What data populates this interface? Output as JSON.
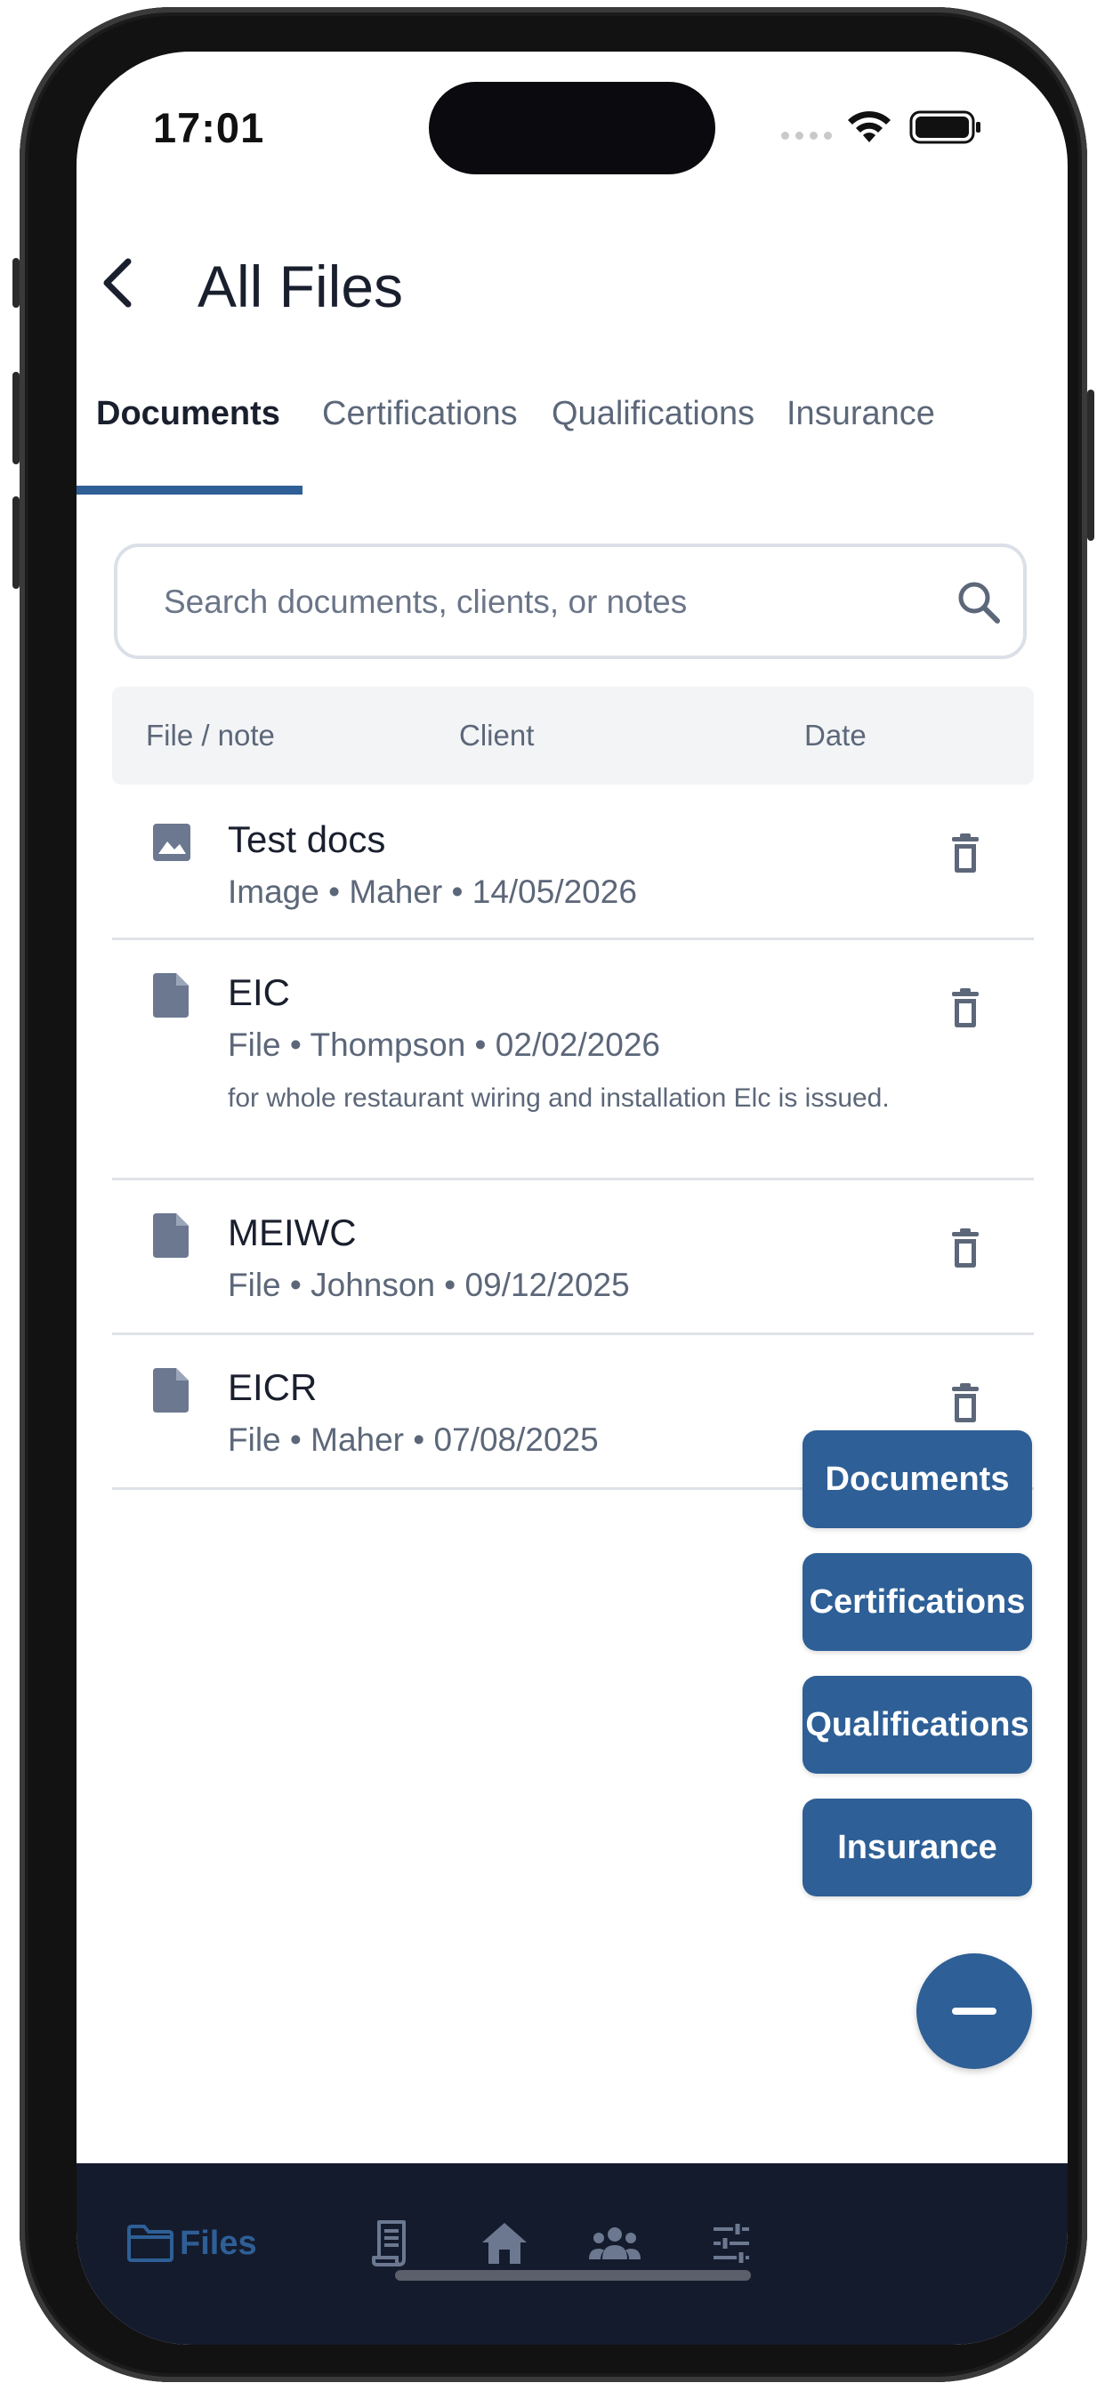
{
  "status_bar": {
    "time": "17:01"
  },
  "header": {
    "title": "All Files"
  },
  "tabs": [
    {
      "label": "Documents",
      "active": true
    },
    {
      "label": "Certifications",
      "active": false
    },
    {
      "label": "Qualifications",
      "active": false
    },
    {
      "label": "Insurance",
      "active": false
    }
  ],
  "search": {
    "placeholder": "Search documents, clients, or notes",
    "value": ""
  },
  "table": {
    "columns": [
      "File / note",
      "Client",
      "Date"
    ],
    "rows": [
      {
        "icon": "image-icon",
        "title": "Test docs",
        "meta": "Image • Maher • 14/05/2026",
        "note": ""
      },
      {
        "icon": "file-icon",
        "title": "EIC",
        "meta": "File • Thompson • 02/02/2026",
        "note": "for whole restaurant wiring and installation Elc is issued."
      },
      {
        "icon": "file-icon",
        "title": "MEIWC",
        "meta": "File • Johnson • 09/12/2025",
        "note": ""
      },
      {
        "icon": "file-icon",
        "title": "EICR",
        "meta": "File • Maher • 07/08/2025",
        "note": ""
      }
    ]
  },
  "fab_menu": {
    "items": [
      "Documents",
      "Certifications",
      "Qualifications",
      "Insurance"
    ]
  },
  "bottom_nav": {
    "items": [
      {
        "icon": "folder-icon",
        "label": "Files",
        "active": true
      },
      {
        "icon": "receipt-icon",
        "label": "",
        "active": false
      },
      {
        "icon": "home-icon",
        "label": "",
        "active": false
      },
      {
        "icon": "people-icon",
        "label": "",
        "active": false
      },
      {
        "icon": "sliders-icon",
        "label": "",
        "active": false
      }
    ]
  },
  "colors": {
    "accent": "#2e5f96",
    "nav_background": "#141b2d",
    "text_primary": "#1a1f2e",
    "text_secondary": "#5c6779",
    "icon_muted": "#6b7890"
  }
}
